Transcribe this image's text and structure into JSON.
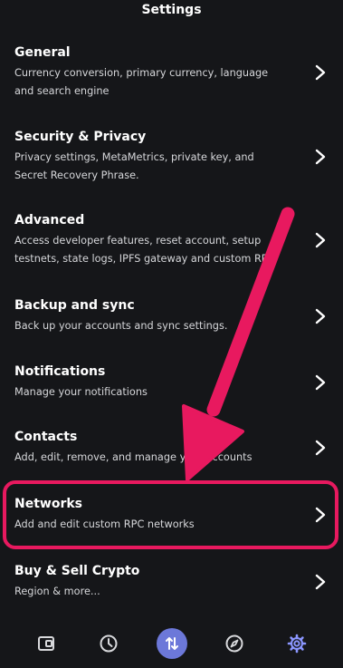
{
  "header": {
    "title": "Settings"
  },
  "rows": [
    {
      "title": "General",
      "desc1": "Currency conversion, primary currency, language",
      "desc2": "and search engine"
    },
    {
      "title": "Security & Privacy",
      "desc1": "Privacy settings, MetaMetrics, private key, and",
      "desc2": "Secret Recovery Phrase."
    },
    {
      "title": "Advanced",
      "desc1": "Access developer features, reset account, setup",
      "desc2": "testnets, state logs, IPFS gateway and custom RPC"
    },
    {
      "title": "Backup and sync",
      "desc1": "Back up your accounts and sync settings.",
      "desc2": ""
    },
    {
      "title": "Notifications",
      "desc1": "Manage your notifications",
      "desc2": ""
    },
    {
      "title": "Contacts",
      "desc1": "Add, edit, remove, and manage your accounts",
      "desc2": ""
    },
    {
      "title": "Networks",
      "desc1": "Add and edit custom RPC networks",
      "desc2": ""
    },
    {
      "title": "Buy & Sell Crypto",
      "desc1": "Region & more...",
      "desc2": ""
    }
  ],
  "tabbar": {
    "items": [
      "wallet-icon",
      "activity-clock-icon",
      "swap-bridge-icon",
      "explore-compass-icon",
      "settings-gear-icon"
    ],
    "active_index": 4
  },
  "colors": {
    "background": "#151619",
    "highlight": "#e8195f",
    "accent": "#6c78d9",
    "active_tab": "#8b96ff"
  }
}
